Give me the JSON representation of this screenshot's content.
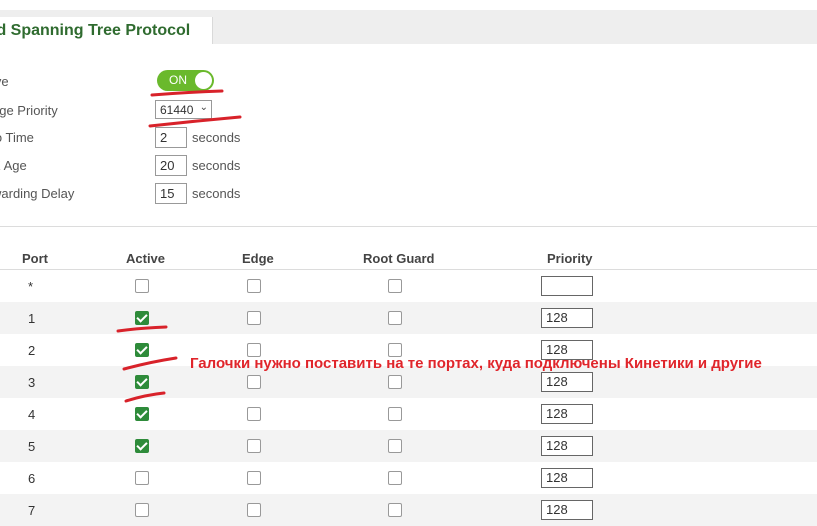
{
  "tab": {
    "title": "id Spanning Tree Protocol"
  },
  "form": {
    "active": {
      "label": "ive",
      "state": "ON"
    },
    "bridge_priority": {
      "label": "dge Priority",
      "value": "61440"
    },
    "hello_time": {
      "label": "lo Time",
      "value": "2",
      "unit": "seconds"
    },
    "max_age": {
      "label": "X Age",
      "value": "20",
      "unit": "seconds"
    },
    "forwarding_delay": {
      "label": "warding Delay",
      "value": "15",
      "unit": "seconds"
    }
  },
  "table": {
    "headers": {
      "port": "Port",
      "active": "Active",
      "edge": "Edge",
      "root_guard": "Root Guard",
      "priority": "Priority"
    },
    "rows": [
      {
        "port": "*",
        "active": false,
        "edge": false,
        "root_guard": false,
        "priority": ""
      },
      {
        "port": "1",
        "active": true,
        "edge": false,
        "root_guard": false,
        "priority": "128"
      },
      {
        "port": "2",
        "active": true,
        "edge": false,
        "root_guard": false,
        "priority": "128"
      },
      {
        "port": "3",
        "active": true,
        "edge": false,
        "root_guard": false,
        "priority": "128"
      },
      {
        "port": "4",
        "active": true,
        "edge": false,
        "root_guard": false,
        "priority": "128"
      },
      {
        "port": "5",
        "active": true,
        "edge": false,
        "root_guard": false,
        "priority": "128"
      },
      {
        "port": "6",
        "active": false,
        "edge": false,
        "root_guard": false,
        "priority": "128"
      },
      {
        "port": "7",
        "active": false,
        "edge": false,
        "root_guard": false,
        "priority": "128"
      }
    ]
  },
  "annotation": {
    "text": "Галочки нужно поставить на те портах, куда подключены Кинетики и другие"
  },
  "colors": {
    "toggle_on": "#6ab92c",
    "checkbox_checked": "#2e8b3a",
    "annotation_red": "#e0252b",
    "title_green": "#2f6b2f"
  }
}
